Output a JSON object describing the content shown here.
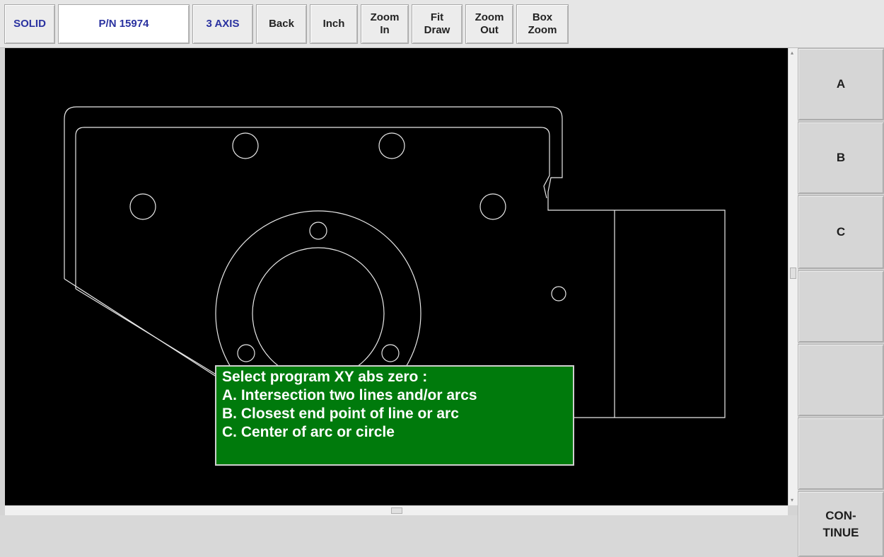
{
  "toolbar": {
    "items": [
      {
        "label": "SOLID",
        "style": "blue"
      },
      {
        "label": "P/N 15974",
        "style": "blue-white"
      },
      {
        "label": "3 AXIS",
        "style": "blue"
      },
      {
        "label": "Back"
      },
      {
        "label": "Inch"
      },
      {
        "label": "Zoom\nIn"
      },
      {
        "label": "Fit\nDraw"
      },
      {
        "label": "Zoom\nOut"
      },
      {
        "label": "Box\nZoom"
      }
    ]
  },
  "softkeys": {
    "a": "A",
    "b": "B",
    "c": "C",
    "key4": "",
    "key5": "",
    "key6": "",
    "continue": "CON-\nTINUE"
  },
  "prompt": {
    "title": "Select program XY abs zero :",
    "option_a": "A. Intersection two lines and/or arcs",
    "option_b": "B. Closest end point of line or arc",
    "option_c": "C. Center of arc or circle"
  },
  "colors": {
    "canvas_background": "#000000",
    "drawing_lines": "#e8e8e8",
    "prompt_background": "#007a0c",
    "toolbar_accent_text": "#2a32a0"
  }
}
